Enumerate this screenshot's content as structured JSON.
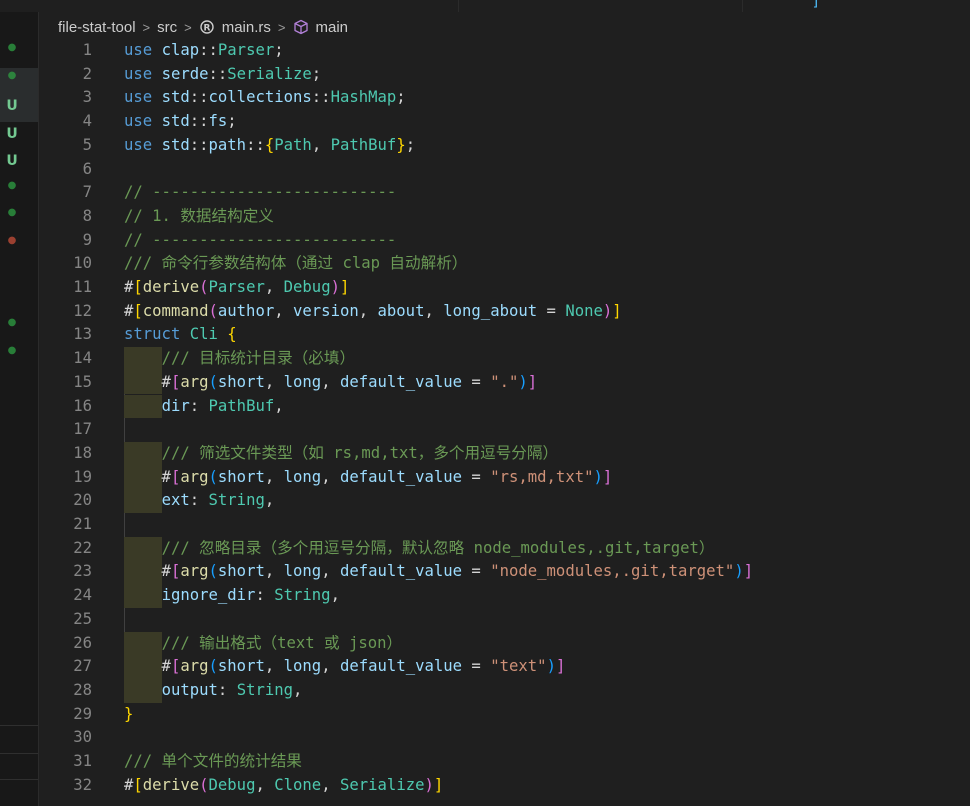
{
  "breadcrumb": {
    "items": [
      "file-stat-tool",
      "src",
      "main.rs",
      "main"
    ]
  },
  "gutter_status": [
    {
      "mark": "●",
      "kind": "green"
    },
    {
      "mark": "●",
      "kind": "green"
    },
    {
      "mark": "U",
      "kind": "untracked"
    },
    {
      "mark": "U",
      "kind": "untracked"
    },
    {
      "mark": "U",
      "kind": "untracked"
    },
    {
      "mark": "●",
      "kind": "green"
    },
    {
      "mark": "●",
      "kind": "green"
    },
    {
      "mark": "●",
      "kind": "red"
    },
    {
      "mark": "●",
      "kind": "green"
    },
    {
      "mark": "●",
      "kind": "green"
    }
  ],
  "colors": {
    "keyword": "#569cd6",
    "type": "#4ec9b0",
    "function": "#dcdcaa",
    "variable": "#9cdcfe",
    "string": "#ce9178",
    "comment": "#6a9955",
    "bracket_1": "#ffd700",
    "bracket_2": "#da70d6",
    "bracket_3": "#179fff"
  },
  "code_lines": [
    [
      [
        "kw",
        "use "
      ],
      [
        "var",
        "clap"
      ],
      [
        "pl",
        "::"
      ],
      [
        "ty",
        "Parser"
      ],
      [
        "pl",
        ";"
      ]
    ],
    [
      [
        "kw",
        "use "
      ],
      [
        "var",
        "serde"
      ],
      [
        "pl",
        "::"
      ],
      [
        "ty",
        "Serialize"
      ],
      [
        "pl",
        ";"
      ]
    ],
    [
      [
        "kw",
        "use "
      ],
      [
        "var",
        "std"
      ],
      [
        "pl",
        "::"
      ],
      [
        "var",
        "collections"
      ],
      [
        "pl",
        "::"
      ],
      [
        "ty",
        "HashMap"
      ],
      [
        "pl",
        ";"
      ]
    ],
    [
      [
        "kw",
        "use "
      ],
      [
        "var",
        "std"
      ],
      [
        "pl",
        "::"
      ],
      [
        "var",
        "fs"
      ],
      [
        "pl",
        ";"
      ]
    ],
    [
      [
        "kw",
        "use "
      ],
      [
        "var",
        "std"
      ],
      [
        "pl",
        "::"
      ],
      [
        "var",
        "path"
      ],
      [
        "pl",
        "::"
      ],
      [
        "b1",
        "{"
      ],
      [
        "ty",
        "Path"
      ],
      [
        "pl",
        ", "
      ],
      [
        "ty",
        "PathBuf"
      ],
      [
        "b1",
        "}"
      ],
      [
        "pl",
        ";"
      ]
    ],
    [],
    [
      [
        "cm",
        "// --------------------------"
      ]
    ],
    [
      [
        "cm",
        "// 1. 数据结构定义"
      ]
    ],
    [
      [
        "cm",
        "// --------------------------"
      ]
    ],
    [
      [
        "cm",
        "/// 命令行参数结构体（通过 clap 自动解析）"
      ]
    ],
    [
      [
        "pl",
        "#"
      ],
      [
        "b1",
        "["
      ],
      [
        "fn",
        "derive"
      ],
      [
        "b2",
        "("
      ],
      [
        "ty",
        "Parser"
      ],
      [
        "pl",
        ", "
      ],
      [
        "ty",
        "Debug"
      ],
      [
        "b2",
        ")"
      ],
      [
        "b1",
        "]"
      ]
    ],
    [
      [
        "pl",
        "#"
      ],
      [
        "b1",
        "["
      ],
      [
        "fn",
        "command"
      ],
      [
        "b2",
        "("
      ],
      [
        "var",
        "author"
      ],
      [
        "pl",
        ", "
      ],
      [
        "var",
        "version"
      ],
      [
        "pl",
        ", "
      ],
      [
        "var",
        "about"
      ],
      [
        "pl",
        ", "
      ],
      [
        "var",
        "long_about"
      ],
      [
        "pl",
        " = "
      ],
      [
        "ty",
        "None"
      ],
      [
        "b2",
        ")"
      ],
      [
        "b1",
        "]"
      ]
    ],
    [
      [
        "kw",
        "struct "
      ],
      [
        "ty",
        "Cli "
      ],
      [
        "b1",
        "{"
      ]
    ],
    [
      [
        "pl",
        "    "
      ],
      [
        "cm",
        "/// 目标统计目录（必填）"
      ]
    ],
    [
      [
        "pl",
        "    #"
      ],
      [
        "b2",
        "["
      ],
      [
        "fn",
        "arg"
      ],
      [
        "b3",
        "("
      ],
      [
        "var",
        "short"
      ],
      [
        "pl",
        ", "
      ],
      [
        "var",
        "long"
      ],
      [
        "pl",
        ", "
      ],
      [
        "var",
        "default_value"
      ],
      [
        "pl",
        " = "
      ],
      [
        "str",
        "\".\""
      ],
      [
        "b3",
        ")"
      ],
      [
        "b2",
        "]"
      ]
    ],
    [
      [
        "pl",
        "    "
      ],
      [
        "var",
        "dir"
      ],
      [
        "pl",
        ": "
      ],
      [
        "ty",
        "PathBuf"
      ],
      [
        "pl",
        ","
      ]
    ],
    [],
    [
      [
        "pl",
        "    "
      ],
      [
        "cm",
        "/// 筛选文件类型（如 rs,md,txt，多个用逗号分隔）"
      ]
    ],
    [
      [
        "pl",
        "    #"
      ],
      [
        "b2",
        "["
      ],
      [
        "fn",
        "arg"
      ],
      [
        "b3",
        "("
      ],
      [
        "var",
        "short"
      ],
      [
        "pl",
        ", "
      ],
      [
        "var",
        "long"
      ],
      [
        "pl",
        ", "
      ],
      [
        "var",
        "default_value"
      ],
      [
        "pl",
        " = "
      ],
      [
        "str",
        "\"rs,md,txt\""
      ],
      [
        "b3",
        ")"
      ],
      [
        "b2",
        "]"
      ]
    ],
    [
      [
        "pl",
        "    "
      ],
      [
        "var",
        "ext"
      ],
      [
        "pl",
        ": "
      ],
      [
        "ty",
        "String"
      ],
      [
        "pl",
        ","
      ]
    ],
    [],
    [
      [
        "pl",
        "    "
      ],
      [
        "cm",
        "/// 忽略目录（多个用逗号分隔，默认忽略 node_modules,.git,target）"
      ]
    ],
    [
      [
        "pl",
        "    #"
      ],
      [
        "b2",
        "["
      ],
      [
        "fn",
        "arg"
      ],
      [
        "b3",
        "("
      ],
      [
        "var",
        "short"
      ],
      [
        "pl",
        ", "
      ],
      [
        "var",
        "long"
      ],
      [
        "pl",
        ", "
      ],
      [
        "var",
        "default_value"
      ],
      [
        "pl",
        " = "
      ],
      [
        "str",
        "\"node_modules,.git,target\""
      ],
      [
        "b3",
        ")"
      ],
      [
        "b2",
        "]"
      ]
    ],
    [
      [
        "pl",
        "    "
      ],
      [
        "var",
        "ignore_dir"
      ],
      [
        "pl",
        ": "
      ],
      [
        "ty",
        "String"
      ],
      [
        "pl",
        ","
      ]
    ],
    [],
    [
      [
        "pl",
        "    "
      ],
      [
        "cm",
        "/// 输出格式（text 或 json）"
      ]
    ],
    [
      [
        "pl",
        "    #"
      ],
      [
        "b2",
        "["
      ],
      [
        "fn",
        "arg"
      ],
      [
        "b3",
        "("
      ],
      [
        "var",
        "short"
      ],
      [
        "pl",
        ", "
      ],
      [
        "var",
        "long"
      ],
      [
        "pl",
        ", "
      ],
      [
        "var",
        "default_value"
      ],
      [
        "pl",
        " = "
      ],
      [
        "str",
        "\"text\""
      ],
      [
        "b3",
        ")"
      ],
      [
        "b2",
        "]"
      ]
    ],
    [
      [
        "pl",
        "    "
      ],
      [
        "var",
        "output"
      ],
      [
        "pl",
        ": "
      ],
      [
        "ty",
        "String"
      ],
      [
        "pl",
        ","
      ]
    ],
    [
      [
        "b1",
        "}"
      ]
    ],
    [],
    [
      [
        "cm",
        "/// 单个文件的统计结果"
      ]
    ],
    [
      [
        "pl",
        "#"
      ],
      [
        "b1",
        "["
      ],
      [
        "fn",
        "derive"
      ],
      [
        "b2",
        "("
      ],
      [
        "ty",
        "Debug"
      ],
      [
        "pl",
        ", "
      ],
      [
        "ty",
        "Clone"
      ],
      [
        "pl",
        ", "
      ],
      [
        "ty",
        "Serialize"
      ],
      [
        "b2",
        ")"
      ],
      [
        "b1",
        "]"
      ]
    ]
  ]
}
